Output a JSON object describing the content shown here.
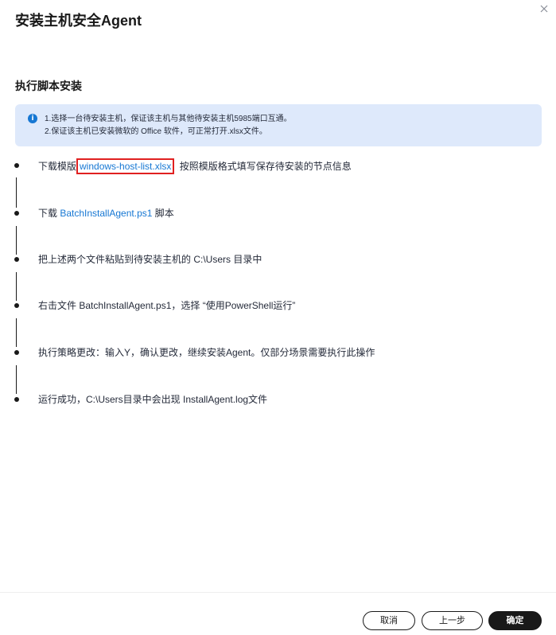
{
  "dialog": {
    "title": "安装主机安全Agent",
    "close_icon": "close-icon"
  },
  "section": {
    "title": "执行脚本安装"
  },
  "notice": {
    "icon": "info-icon",
    "icon_glyph": "i",
    "lines": [
      "1.选择一台待安装主机，保证该主机与其他待安装主机5985端口互通。",
      "2.保证该主机已安装微软的 Office 软件，可正常打开.xlsx文件。"
    ]
  },
  "steps": [
    {
      "prefix": "下载模版",
      "link": "windows-host-list.xlsx",
      "suffix": "按照模版格式填写保存待安装的节点信息"
    },
    {
      "prefix": "下载 ",
      "link": "BatchInstallAgent.ps1",
      "suffix": " 脚本"
    },
    {
      "text": "把上述两个文件粘贴到待安装主机的 C:\\Users 目录中"
    },
    {
      "text": "右击文件 BatchInstallAgent.ps1，选择 “使用PowerShell运行”"
    },
    {
      "text": "执行策略更改：输入Y，确认更改，继续安装Agent。仅部分场景需要执行此操作"
    },
    {
      "text": "运行成功，C:\\Users目录中会出现 InstallAgent.log文件"
    }
  ],
  "footer": {
    "cancel_label": "取消",
    "prev_label": "上一步",
    "ok_label": "确定"
  },
  "colors": {
    "link": "#1677d3",
    "notice_bg": "#dee9fb",
    "primary_button": "#191919",
    "highlight_box": "#e02020"
  }
}
